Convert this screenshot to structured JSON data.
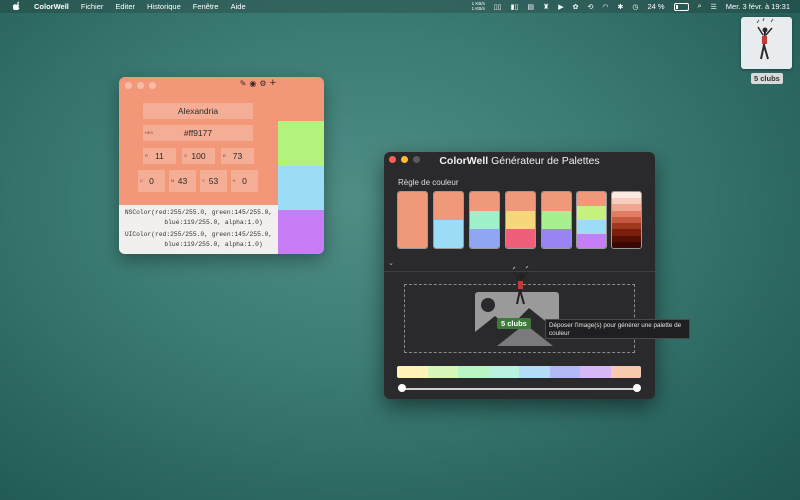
{
  "menubar": {
    "apple": "",
    "app_name": "ColorWell",
    "menus": [
      "Fichier",
      "Editer",
      "Historique",
      "Fenêtre",
      "Aide"
    ],
    "net_up": "1 KB/s",
    "net_down": "1 KB/s",
    "battery_percent": "24 %",
    "battery_level": 0.24,
    "datetime": "Mer. 3 févr. à  19:31"
  },
  "desktop": {
    "thumbnail_label": "5 clubs"
  },
  "color_window": {
    "name": "Alexandria",
    "hex_label": "HEX",
    "hex": "#ff9177",
    "rgb": [
      {
        "label": "R",
        "value": "11"
      },
      {
        "label": "G",
        "value": "100"
      },
      {
        "label": "B",
        "value": "73"
      }
    ],
    "cmyk": [
      {
        "label": "C",
        "value": "0"
      },
      {
        "label": "M",
        "value": "43"
      },
      {
        "label": "Y",
        "value": "53"
      },
      {
        "label": "K",
        "value": "0"
      }
    ],
    "ns_line1": "NSColor(red:255/255.0, green:145/255.0,",
    "ns_line2": "blue:119/255.0, alpha:1.0)",
    "ui_line1": "UIColor(red:255/255.0, green:145/255.0,",
    "ui_line2": "blue:119/255.0, alpha:1.0)",
    "swatches": [
      "#b3f27c",
      "#9bdcf6",
      "#c77df6"
    ],
    "main_color": "#f29879"
  },
  "palette_window": {
    "title_brand": "ColorWell",
    "title_rest": " Générateur de Palettes",
    "rule_label": "Règle de couleur",
    "palettes": [
      [
        "#f0987a"
      ],
      [
        "#f0987a",
        "#9bdcf6"
      ],
      [
        "#f0987a",
        "#9ef0c8",
        "#8fa7f2"
      ],
      [
        "#f0987a",
        "#f7d77c",
        "#ef5f79"
      ],
      [
        "#f0987a",
        "#a6f08f",
        "#9a83f2"
      ],
      [
        "#f0987a",
        "#c4f27c",
        "#9bdcf6",
        "#c77df6"
      ],
      [
        "#fbe9e2",
        "#f6cdbf",
        "#f0a78f",
        "#e07d62",
        "#c65a40",
        "#a0381f",
        "#7a1e0e",
        "#551005",
        "#3a0802"
      ]
    ],
    "drop_tooltip": "Déposer l'image(s) pour générer une palette de couleur",
    "drag_badge": "5 clubs",
    "generated_bar": [
      "#fff3b8",
      "#d6f7b8",
      "#b6f7c4",
      "#b8f3e2",
      "#b3dcf7",
      "#b3b8f7",
      "#d7b8f7",
      "#f6c9b0"
    ]
  }
}
